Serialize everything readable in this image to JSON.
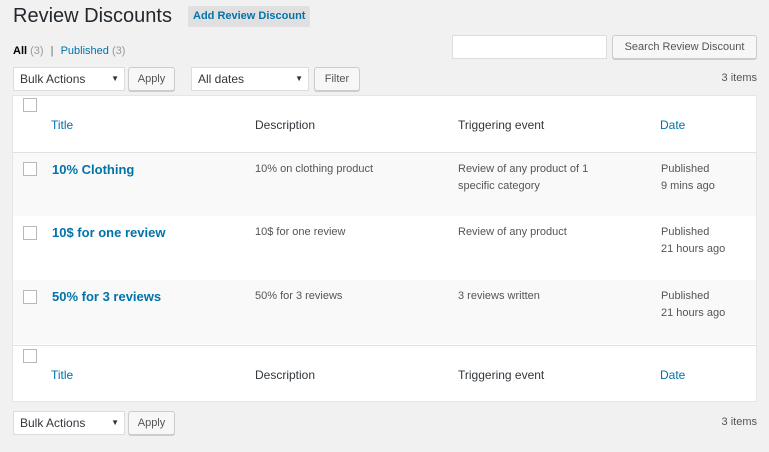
{
  "header": {
    "title": "Review Discounts",
    "add_button": "Add Review Discount"
  },
  "views": {
    "all_label": "All",
    "all_count": "(3)",
    "separator": "|",
    "published_label": "Published",
    "published_count": "(3)"
  },
  "search": {
    "value": "",
    "button": "Search Review Discount"
  },
  "top_nav": {
    "bulk_actions": "Bulk Actions",
    "apply": "Apply",
    "dates": "All dates",
    "filter": "Filter",
    "items": "3 items"
  },
  "bottom_nav": {
    "bulk_actions": "Bulk Actions",
    "apply": "Apply",
    "items": "3 items"
  },
  "table": {
    "columns": {
      "title": "Title",
      "description": "Description",
      "trigger": "Triggering event",
      "date": "Date"
    },
    "rows": [
      {
        "title": "10% Clothing",
        "description": "10% on clothing product",
        "trigger_line1": "Review of any product of 1",
        "trigger_line2": "specific category",
        "status": "Published",
        "time": "9 mins ago"
      },
      {
        "title": "10$ for one review",
        "description": "10$ for one review",
        "trigger_line1": "Review of any product",
        "trigger_line2": "",
        "status": "Published",
        "time": "21 hours ago"
      },
      {
        "title": "50% for 3 reviews",
        "description": "50% for 3 reviews",
        "trigger_line1": "3 reviews written",
        "trigger_line2": "",
        "status": "Published",
        "time": "21 hours ago"
      }
    ]
  },
  "icons": {
    "dropdown": "chevron-down-icon"
  },
  "colors": {
    "link": "#0073aa",
    "background": "#f1f1f1"
  }
}
